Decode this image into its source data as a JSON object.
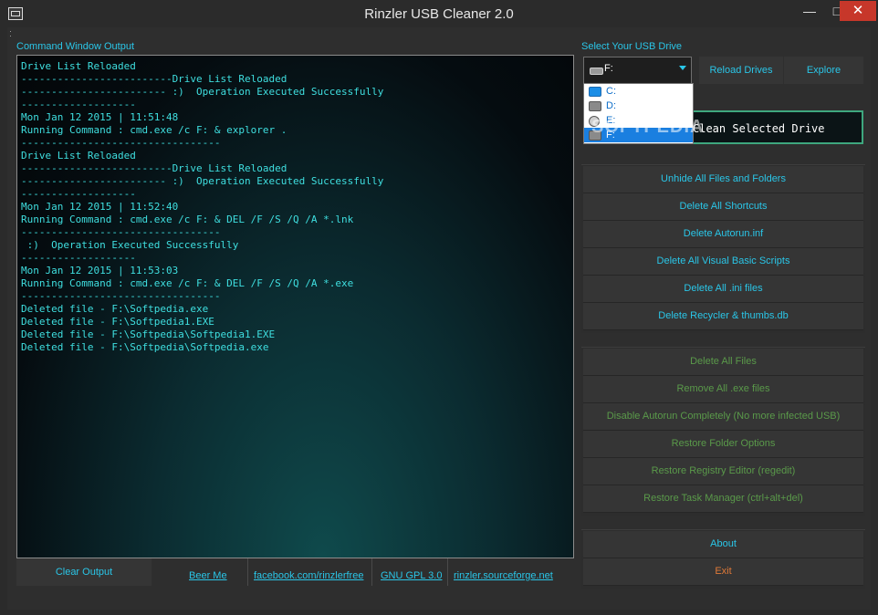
{
  "window": {
    "title": "Rinzler USB Cleaner 2.0",
    "minimize": "—",
    "maximize": "□",
    "close": "✕"
  },
  "console": {
    "label": "Command Window Output",
    "lines": [
      "Drive List Reloaded",
      "-------------------------Drive List Reloaded",
      "------------------------ :)  Operation Executed Successfully",
      "-------------------",
      "Mon Jan 12 2015 | 11:51:48",
      "Running Command : cmd.exe /c F: & explorer .",
      "---------------------------------",
      "Drive List Reloaded",
      "-------------------------Drive List Reloaded",
      "------------------------ :)  Operation Executed Successfully",
      "-------------------",
      "Mon Jan 12 2015 | 11:52:40",
      "Running Command : cmd.exe /c F: & DEL /F /S /Q /A *.lnk",
      "---------------------------------",
      " :)  Operation Executed Successfully",
      "-------------------",
      "Mon Jan 12 2015 | 11:53:03",
      "Running Command : cmd.exe /c F: & DEL /F /S /Q /A *.exe",
      "---------------------------------",
      "Deleted file - F:\\Softpedia.exe",
      "Deleted file - F:\\Softpedia1.EXE",
      "Deleted file - F:\\Softpedia\\Softpedia1.EXE",
      "Deleted file - F:\\Softpedia\\Softpedia.exe"
    ]
  },
  "bottom": {
    "clear_output": "Clear Output",
    "beer_me": "Beer Me",
    "facebook": "facebook.com/rinzlerfree",
    "license": "GNU GPL 3.0",
    "sourceforge": "rinzler.sourceforge.net"
  },
  "drive": {
    "label": "Select Your USB Drive",
    "selected": "F:",
    "options": [
      "C:",
      "D:",
      "E:",
      "F:"
    ],
    "reload": "Reload Drives",
    "explore": "Explore",
    "clean": "Clean Selected Drive"
  },
  "actions_blue": [
    "Unhide All Files and Folders",
    "Delete All Shortcuts",
    "Delete Autorun.inf",
    "Delete All Visual Basic Scripts",
    "Delete All .ini files",
    "Delete Recycler & thumbs.db"
  ],
  "actions_green": [
    "Delete All Files",
    "Remove All .exe files",
    "Disable Autorun Completely (No more infected USB)",
    "Restore Folder Options",
    "Restore Registry Editor (regedit)",
    "Restore Task Manager (ctrl+alt+del)"
  ],
  "about": "About",
  "exit": "Exit",
  "watermark": "SOFTPEDIA",
  "colors": {
    "accent": "#2ac6e8",
    "green": "#5a9a4a",
    "exit": "#e07a38",
    "close": "#c7372a"
  }
}
